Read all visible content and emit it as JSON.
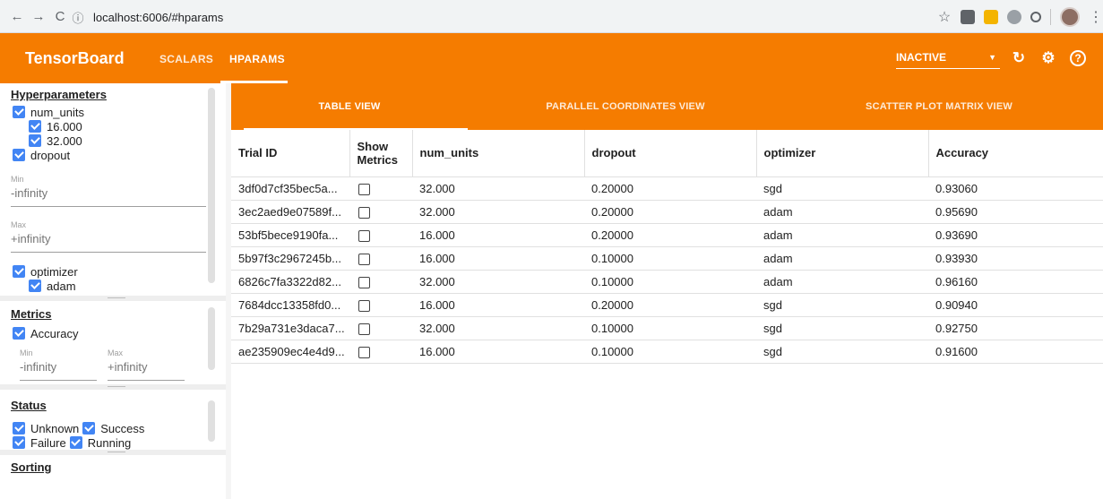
{
  "browser": {
    "back_icon": "←",
    "forward_icon": "→",
    "reload_icon": "C",
    "url": "localhost:6006/#hparams",
    "info_icon": "ⓘ",
    "star_icon": "☆",
    "menu_icon": "⋮"
  },
  "app": {
    "brand": "TensorBoard",
    "tabs": [
      "SCALARS",
      "HPARAMS"
    ],
    "status_value": "INACTIVE",
    "accent_color": "#f57c00"
  },
  "sidebar": {
    "hyperparameters": {
      "title": "Hyperparameters",
      "items": [
        {
          "label": "num_units",
          "checked": true,
          "values": [
            "16.000",
            "32.000"
          ]
        },
        {
          "label": "dropout",
          "checked": true
        },
        {
          "label": "optimizer",
          "checked": true,
          "values": [
            "adam"
          ]
        }
      ],
      "min_label": "Min",
      "min_value": "-infinity",
      "max_label": "Max",
      "max_value": "+infinity"
    },
    "metrics": {
      "title": "Metrics",
      "item": "Accuracy",
      "min_label": "Min",
      "min_value": "-infinity",
      "max_label": "Max",
      "max_value": "+infinity"
    },
    "status": {
      "title": "Status",
      "items": [
        "Unknown",
        "Success",
        "Failure",
        "Running"
      ]
    },
    "sorting": {
      "title": "Sorting"
    }
  },
  "views": {
    "tabs": [
      "TABLE VIEW",
      "PARALLEL COORDINATES VIEW",
      "SCATTER PLOT MATRIX VIEW"
    ],
    "active": "TABLE VIEW"
  },
  "table": {
    "headers": [
      "Trial ID",
      "Show Metrics",
      "num_units",
      "dropout",
      "optimizer",
      "Accuracy"
    ],
    "rows": [
      {
        "trial_id": "3df0d7cf35bec5a...",
        "num_units": "32.000",
        "dropout": "0.20000",
        "optimizer": "sgd",
        "accuracy": "0.93060"
      },
      {
        "trial_id": "3ec2aed9e07589f...",
        "num_units": "32.000",
        "dropout": "0.20000",
        "optimizer": "adam",
        "accuracy": "0.95690"
      },
      {
        "trial_id": "53bf5bece9190fa...",
        "num_units": "16.000",
        "dropout": "0.20000",
        "optimizer": "adam",
        "accuracy": "0.93690"
      },
      {
        "trial_id": "5b97f3c2967245b...",
        "num_units": "16.000",
        "dropout": "0.10000",
        "optimizer": "adam",
        "accuracy": "0.93930"
      },
      {
        "trial_id": "6826c7fa3322d82...",
        "num_units": "32.000",
        "dropout": "0.10000",
        "optimizer": "adam",
        "accuracy": "0.96160"
      },
      {
        "trial_id": "7684dcc13358fd0...",
        "num_units": "16.000",
        "dropout": "0.20000",
        "optimizer": "sgd",
        "accuracy": "0.90940"
      },
      {
        "trial_id": "7b29a731e3daca7...",
        "num_units": "32.000",
        "dropout": "0.10000",
        "optimizer": "sgd",
        "accuracy": "0.92750"
      },
      {
        "trial_id": "ae235909ec4e4d9...",
        "num_units": "16.000",
        "dropout": "0.10000",
        "optimizer": "sgd",
        "accuracy": "0.91600"
      }
    ]
  }
}
